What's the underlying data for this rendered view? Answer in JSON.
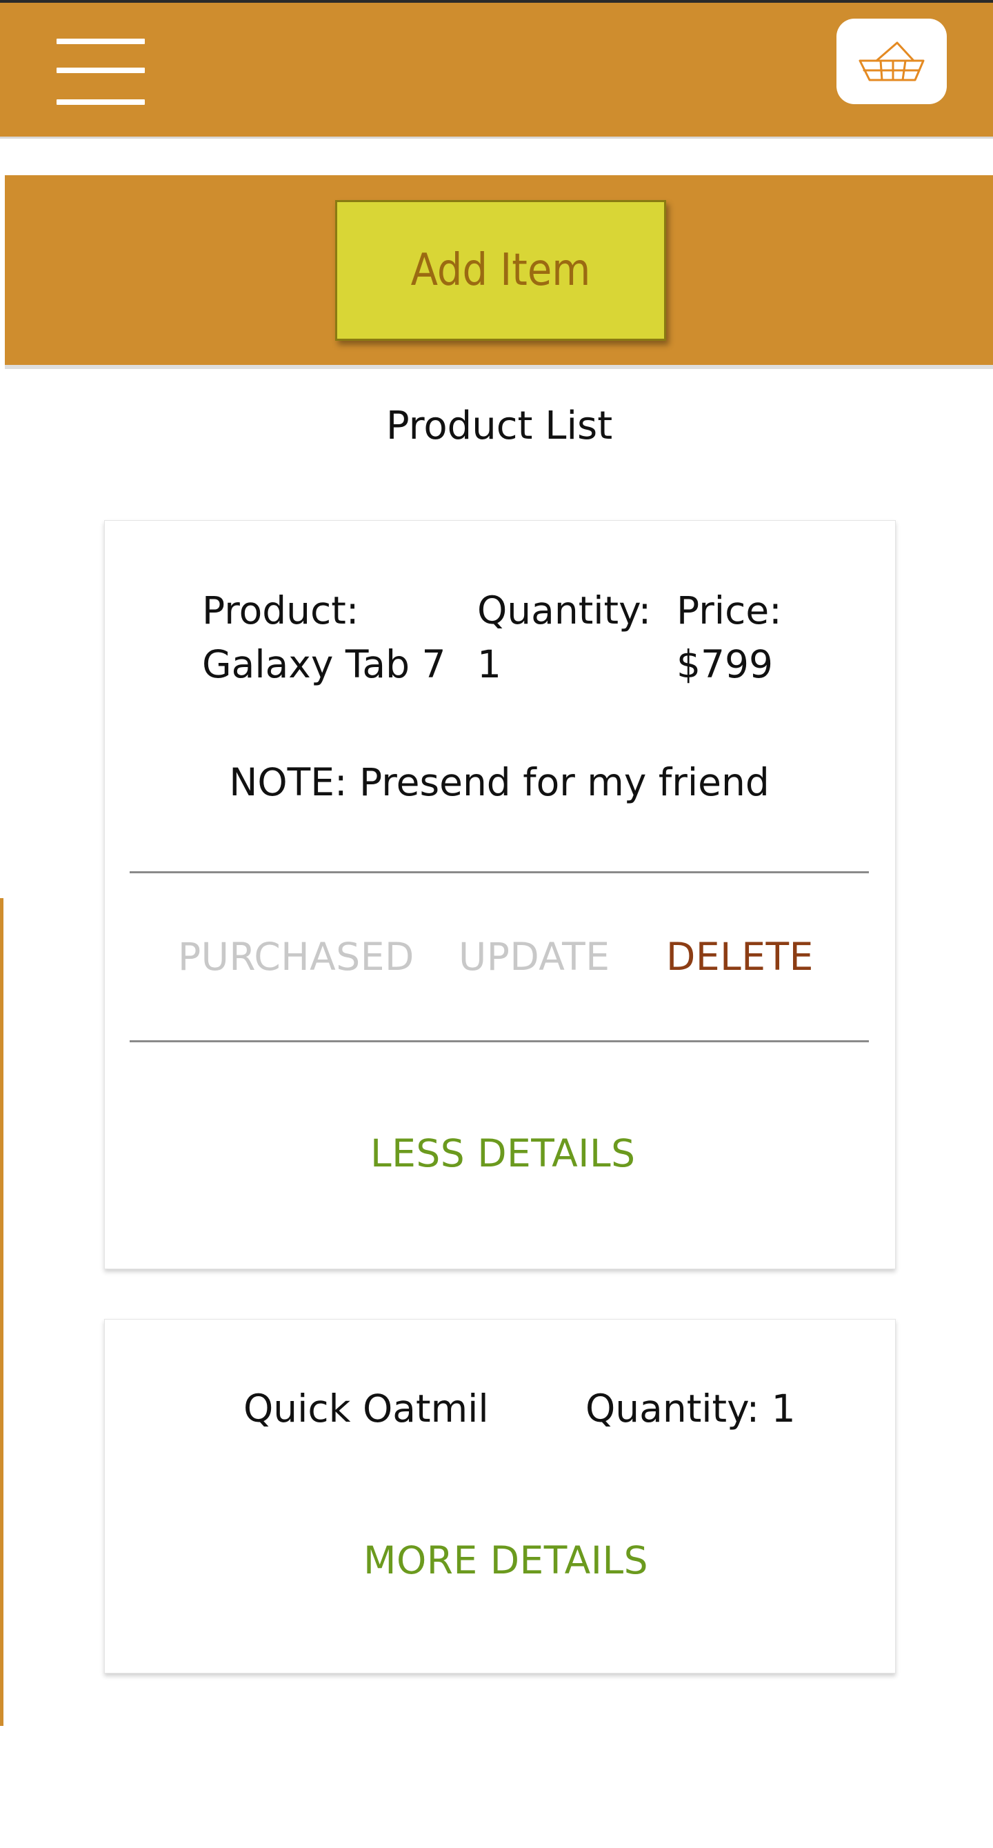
{
  "header": {
    "menu_icon": "hamburger-menu-icon",
    "cart_icon": "basket-icon",
    "brand_color": "#cf8d2e"
  },
  "banner": {
    "add_item_label": "Add Item",
    "button_color": "#d9d636"
  },
  "list": {
    "title": "Product List",
    "items": [
      {
        "product_label": "Product:",
        "product_value": "Galaxy Tab 7",
        "quantity_label": "Quantity:",
        "quantity_value": "1",
        "price_label": "Price:",
        "price_value": "$799",
        "note": "NOTE: Presend for my friend",
        "actions": {
          "purchased": "PURCHASED",
          "update": "UPDATE",
          "delete": "DELETE"
        },
        "toggle_label": "LESS DETAILS"
      },
      {
        "product_value": "Quick Oatmil",
        "quantity_text": "Quantity: 1",
        "toggle_label": "MORE DETAILS"
      }
    ]
  }
}
